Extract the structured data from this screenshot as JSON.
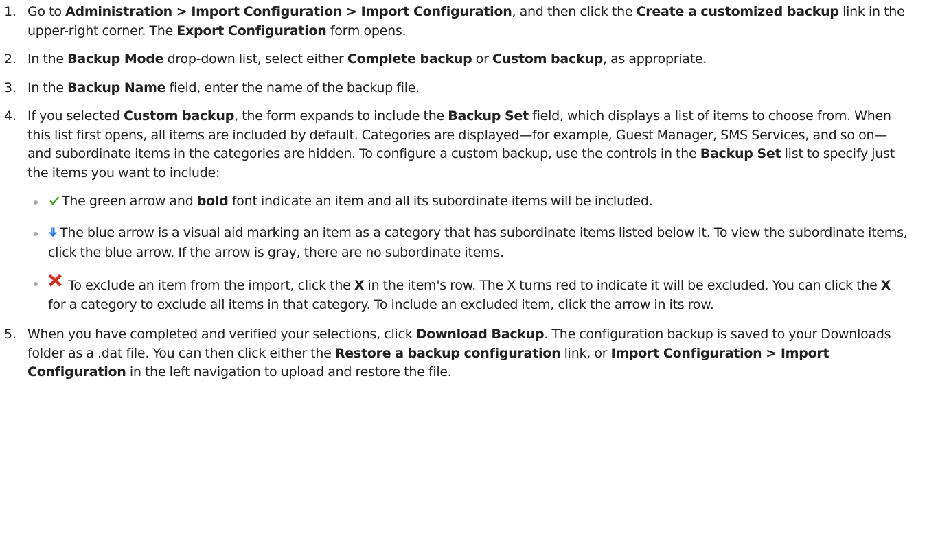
{
  "steps": [
    {
      "num": "1.",
      "t1": "Go to ",
      "b1": "Administration > Import Configuration > Import Configuration",
      "t2": ", and then click the ",
      "b2": "Create a customized backup",
      "t3": " link in the upper-right corner. The ",
      "b3": "Export Configuration",
      "t4": " form opens."
    },
    {
      "num": "2.",
      "t1": "In the ",
      "b1": "Backup Mode",
      "t2": " drop-down list, select either ",
      "b2": "Complete backup",
      "t3": " or ",
      "b3": "Custom backup",
      "t4": ", as appropriate."
    },
    {
      "num": "3.",
      "t1": "In the ",
      "b1": "Backup Name",
      "t2": " field, enter the name of the backup file."
    },
    {
      "num": "4.",
      "t1": "If you selected ",
      "b1": "Custom backup",
      "t2": ", the form expands to include the ",
      "b2": "Backup Set",
      "t3": " field, which displays a list of items to choose from. When this list first opens, all items are included by default. Categories are displayed—for example, Guest Manager, SMS Services, and so on—and subordinate items in the categories are hidden. To configure a custom backup, use the controls in the ",
      "b3": "Backup Set",
      "t4": " list to specify just the items you want to include:",
      "bullets": [
        {
          "icon": "green-check-icon",
          "t1": "The green arrow and ",
          "b1": "bold",
          "t2": " font indicate an item and all its subordinate items will be included."
        },
        {
          "icon": "blue-down-arrow-icon",
          "t1": "The blue arrow is a visual aid marking an item as a category that has subordinate items listed below it. To view the subordinate items, click the blue arrow. If the arrow is gray, there are no subordinate items."
        },
        {
          "icon": "red-x-icon",
          "t1": " To exclude an item from the import, click the ",
          "b1": "X",
          "t2": " in the item's row. The X turns red to indicate it will be excluded. You can click the ",
          "b2": "X",
          "t3": " for a category to exclude all items in that category. To include an excluded item, click the arrow in its row."
        }
      ]
    },
    {
      "num": "5.",
      "t1": "When you have completed and verified your selections, click ",
      "b1": "Download Backup",
      "t2": ". The configuration backup is saved to your Downloads folder as a .dat file. You can then click either the ",
      "b2": "Restore a backup configuration",
      "t3": " link, or ",
      "b3": "Import Configuration > Import Configuration",
      "t4": " in the left navigation to upload and restore the file."
    }
  ],
  "colors": {
    "text": "#222222",
    "bullet": "#a9a9a9",
    "check": "#4fa82e",
    "arrow": "#2f7be0",
    "x": "#d42a1c"
  }
}
